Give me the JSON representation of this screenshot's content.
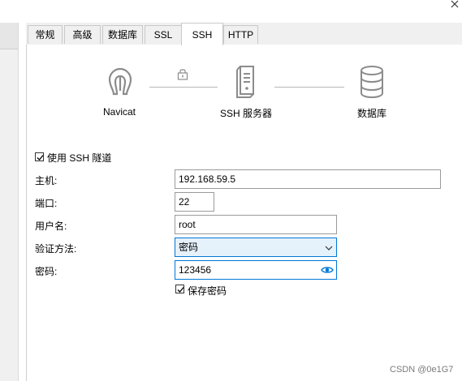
{
  "tabs": [
    {
      "label": "常规"
    },
    {
      "label": "高级"
    },
    {
      "label": "数据库"
    },
    {
      "label": "SSL"
    },
    {
      "label": "SSH"
    },
    {
      "label": "HTTP"
    }
  ],
  "active_tab": "SSH",
  "diagram": {
    "client_label": "Navicat",
    "server_label": "SSH 服务器",
    "database_label": "数据库"
  },
  "use_ssh_tunnel": {
    "label": "使用 SSH 隧道",
    "checked": true
  },
  "form": {
    "host_label": "主机:",
    "host_value": "192.168.59.5",
    "port_label": "端口:",
    "port_value": "22",
    "username_label": "用户名:",
    "username_value": "root",
    "auth_label": "验证方法:",
    "auth_value": "密码",
    "password_label": "密码:",
    "password_value": "123456",
    "save_password_label": "保存密码",
    "save_password_checked": true
  },
  "watermark": "CSDN @0e1G7",
  "colors": {
    "accent": "#0078d7",
    "select_bg": "#e5f1fb",
    "icon_gray": "#8c8c8c"
  }
}
